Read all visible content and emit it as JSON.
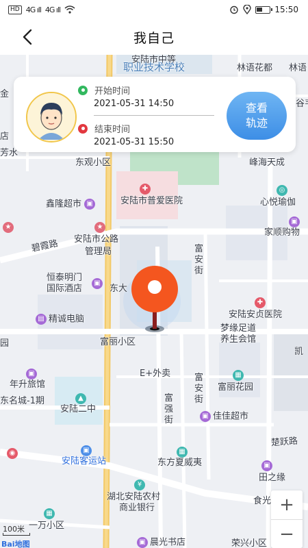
{
  "status_bar": {
    "network_tags": [
      "HD",
      "HD"
    ],
    "signal": [
      "4G ıll",
      "4G ıll"
    ],
    "time": "15:50"
  },
  "header": {
    "title": "我自己",
    "back_icon": "chevron-left-icon"
  },
  "card": {
    "avatar_icon": "user-avatar-icon",
    "start_label": "开始时间",
    "start_time": "2021-05-31 14:50",
    "end_label": "结束时间",
    "end_time": "2021-05-31 15:50",
    "track_button_line1": "查看",
    "track_button_line2": "轨迹",
    "start_color": "#32b85f",
    "end_color": "#e2383f",
    "button_color": "#3d8ee6"
  },
  "map": {
    "pois": {
      "school_line1": "安陆市中等",
      "school_line2": "职业技术学校",
      "linyu": "林语花都",
      "linyu2": "林语",
      "gu": "谷韦",
      "dongguan": "东观小区",
      "fenghai": "峰海天成",
      "xinlong": "鑫隆超市",
      "puai": "安陆市普爱医院",
      "xinyue": "心悦瑜伽",
      "jiashun": "家顺购物",
      "bixia": "碧霞路",
      "gonglu1": "安陆市公路",
      "gonglu2": "管理局",
      "fuan_a": "富安街",
      "hengtai1": "恒泰明门",
      "hengtai2": "国际酒店",
      "dongda": "东大",
      "anzhen": "安陆安贞医院",
      "jingcheng": "精诚电脑",
      "mengyuan1": "梦缘足道",
      "mengyuan2": "养生会馆",
      "fuli_xq": "富丽小区",
      "kai": "凯",
      "yuan": "园",
      "eplus": "E+外卖",
      "fuan_b": "富安街",
      "fuli_hy": "富丽花园",
      "niansheng": "年升旅馆",
      "mingcheng": "东名城-1期",
      "erzhong": "安陆二中",
      "fuqiang": "富强街",
      "jiajia": "佳佳超市",
      "chuyue": "楚跃路",
      "keyun": "安陆客运站",
      "dongfang": "东方夏威夷",
      "tianzhi": "田之缘",
      "bank1": "湖北安陆农村",
      "bank2": "商业银行",
      "shiguang": "食光",
      "yiwan": "一万小区",
      "chenguang": "晨光书店",
      "rongxing": "荣兴小区",
      "jin": "金",
      "dian": "店",
      "fang": "芳水"
    },
    "scale_label": "100米",
    "logo_text": "Bai地图",
    "zoom_in": "+",
    "zoom_out": "−",
    "pin_icon": "location-pin-icon"
  }
}
